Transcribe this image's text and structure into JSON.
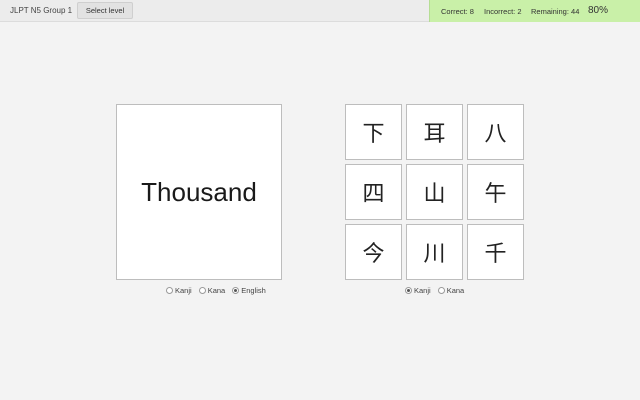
{
  "header": {
    "title": "JLPT N5 Group 1",
    "select_level_label": "Select level"
  },
  "stats": {
    "correct": "Correct: 8",
    "incorrect": "Incorrect: 2",
    "remaining": "Remaining: 44",
    "score": "80%",
    "background": "#c9f0a8"
  },
  "prompt_card": {
    "word": "Thousand"
  },
  "prompt_options": [
    {
      "label": "Kanji",
      "checked": false
    },
    {
      "label": "Kana",
      "checked": false
    },
    {
      "label": "English",
      "checked": true
    }
  ],
  "answers": [
    "下",
    "耳",
    "八",
    "四",
    "山",
    "午",
    "今",
    "川",
    "千"
  ],
  "answer_options": [
    {
      "label": "Kanji",
      "checked": true
    },
    {
      "label": "Kana",
      "checked": false
    }
  ]
}
